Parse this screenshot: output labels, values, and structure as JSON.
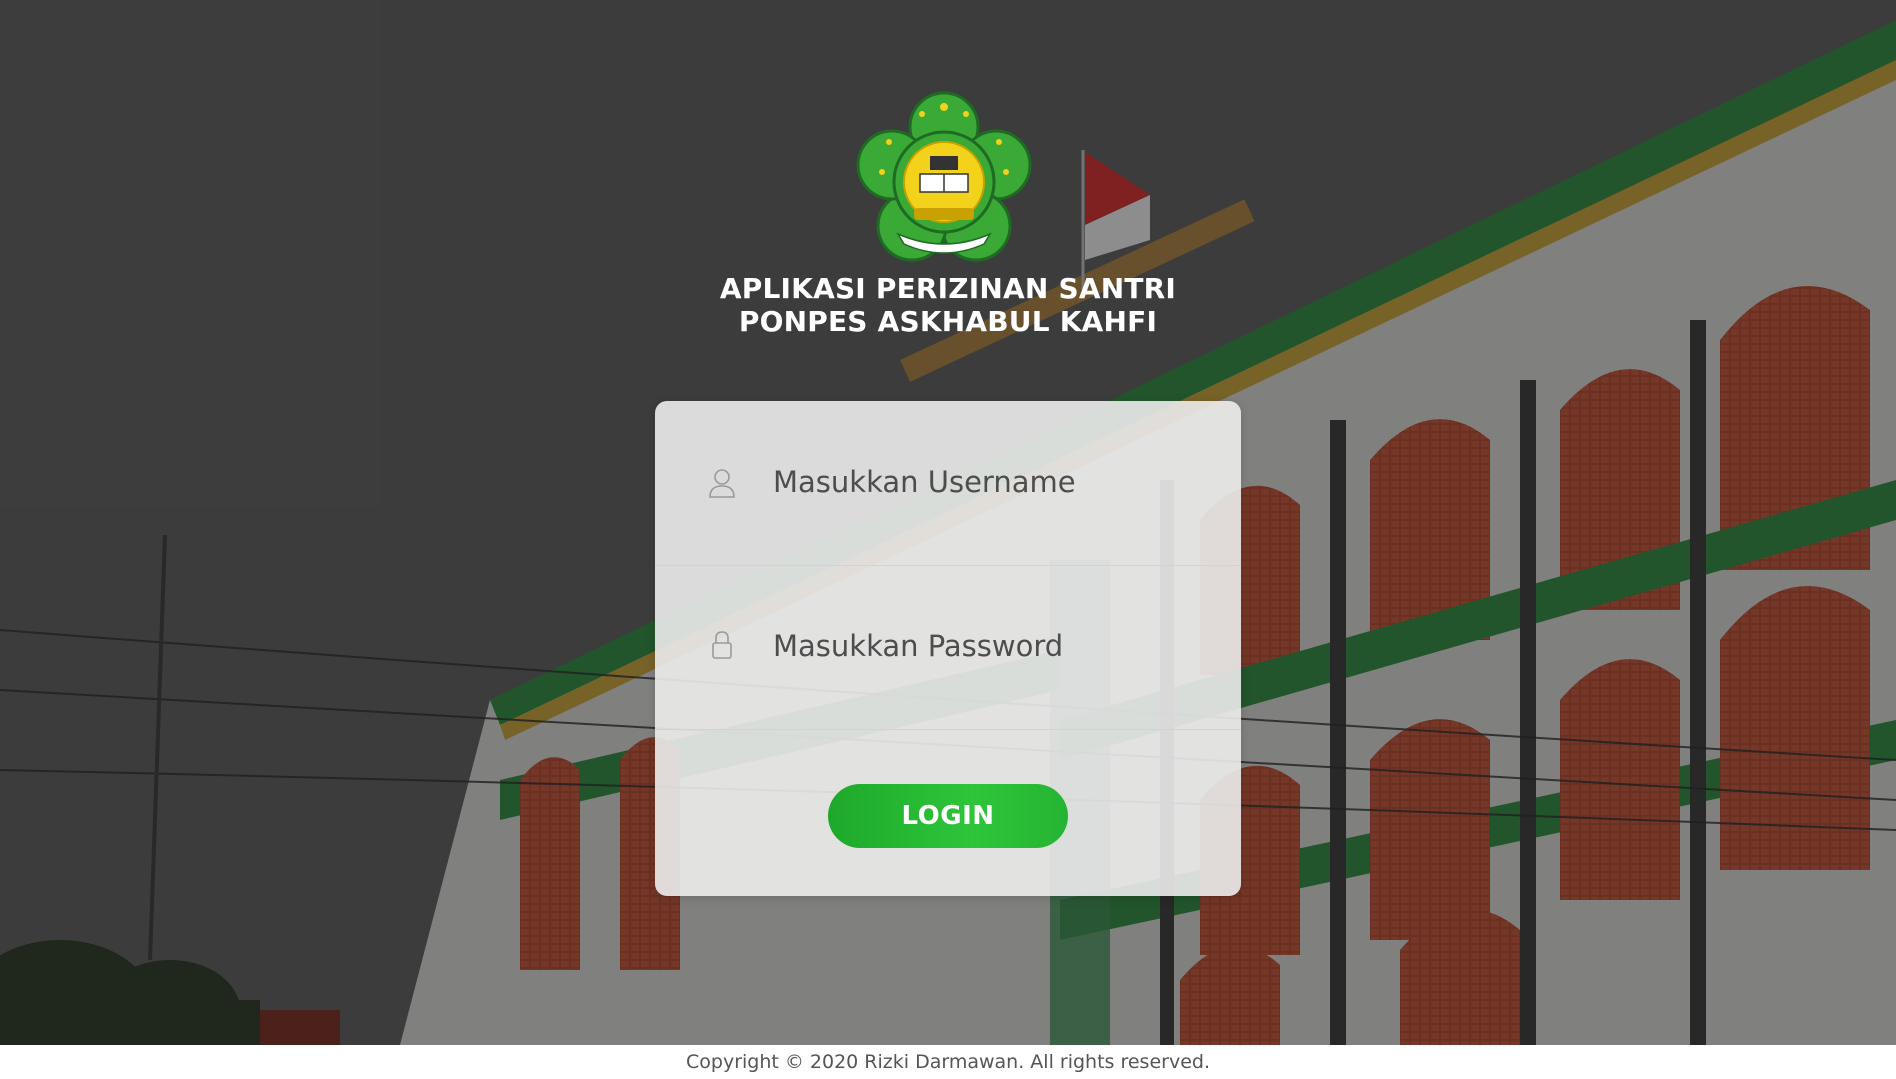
{
  "header": {
    "title_line1": "APLIKASI PERIZINAN SANTRI",
    "title_line2": "PONPES ASKHABUL KAHFI"
  },
  "logo": {
    "icon": "kemenag-logo",
    "colors": {
      "green": "#3aa935",
      "yellow": "#f2d21a"
    }
  },
  "form": {
    "username": {
      "placeholder": "Masukkan Username",
      "value": "",
      "icon": "user-icon"
    },
    "password": {
      "placeholder": "Masukkan Password",
      "value": "",
      "icon": "lock-icon"
    },
    "login_label": "LOGIN"
  },
  "footer": {
    "copyright": "Copyright © 2020 Rizki Darmawan. All rights reserved."
  },
  "colors": {
    "accent": "#2ec53a",
    "background_dim": "#565656",
    "card": "#ececec"
  }
}
